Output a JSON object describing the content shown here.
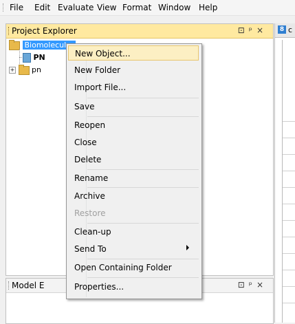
{
  "menubar": {
    "items": [
      "File",
      "Edit",
      "Evaluate",
      "View",
      "Format",
      "Window",
      "Help"
    ]
  },
  "project_explorer": {
    "title": "Project Explorer",
    "buttons": [
      "⊡",
      "ᵖ",
      "×"
    ],
    "tree": [
      {
        "label": "Biomolecular",
        "selected": true
      },
      {
        "label": "PN"
      },
      {
        "label": "pn"
      }
    ]
  },
  "model_explorer": {
    "title": "Model E",
    "buttons": [
      "⊡",
      "ᵖ",
      "×"
    ]
  },
  "right_panel": {
    "tab_glyph": "8",
    "tab_text": "c"
  },
  "context_menu": {
    "items": [
      {
        "label": "New Object...",
        "highlighted": true
      },
      {
        "label": "New Folder"
      },
      {
        "label": "Import File..."
      },
      {
        "label": "Save"
      },
      {
        "label": "Reopen"
      },
      {
        "label": "Close"
      },
      {
        "label": "Delete"
      },
      {
        "label": "Rename"
      },
      {
        "label": "Archive"
      },
      {
        "label": "Restore",
        "disabled": true
      },
      {
        "label": "Clean-up"
      },
      {
        "label": "Send To",
        "submenu": true
      },
      {
        "label": "Open Containing Folder"
      },
      {
        "label": "Properties..."
      }
    ]
  },
  "colors": {
    "selection": "#3399ff",
    "panel_title_active": "#ffe9a0",
    "menu_highlight": "#fcefc3"
  }
}
